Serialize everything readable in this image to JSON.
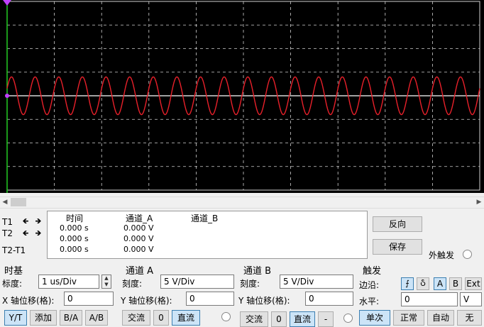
{
  "cursors": {
    "labels": [
      "T1",
      "T2",
      "T2-T1"
    ],
    "headers": {
      "time": "时间",
      "channel_a": "通道_A",
      "channel_b": "通道_B"
    },
    "rows": [
      {
        "time": "0.000 s",
        "channel_a": "0.000 V"
      },
      {
        "time": "0.000 s",
        "channel_a": "0.000 V"
      },
      {
        "time": "0.000 s",
        "channel_a": "0.000 V"
      }
    ]
  },
  "actions": {
    "reverse": "反向",
    "save": "保存",
    "ext_trigger": "外触发"
  },
  "timebase": {
    "title": "时基",
    "scale_label": "标度:",
    "scale_value": "1 us/Div",
    "xpos_label": "X 轴位移(格):",
    "xpos_value": "0",
    "modes": [
      "Y/T",
      "添加",
      "B/A",
      "A/B"
    ]
  },
  "channel_a": {
    "title": "通道 A",
    "scale_label": "刻度:",
    "scale_value": "5  V/Div",
    "ypos_label": "Y 轴位移(格):",
    "ypos_value": "0",
    "coupling": [
      "交流",
      "0",
      "直流"
    ]
  },
  "channel_b": {
    "title": "通道 B",
    "scale_label": "刻度:",
    "scale_value": "5  V/Div",
    "ypos_label": "Y 轴位移(格):",
    "ypos_value": "0",
    "coupling": [
      "交流",
      "0",
      "直流",
      "-"
    ]
  },
  "trigger": {
    "title": "触发",
    "edge_label": "边沿:",
    "edge_icons": [
      "rising-edge-icon",
      "falling-edge-icon"
    ],
    "sources": [
      "A",
      "B",
      "Ext"
    ],
    "level_label": "水平:",
    "level_value": "0",
    "level_unit": "V",
    "modes": [
      "单次",
      "正常",
      "自动",
      "无"
    ]
  },
  "colors": {
    "trace": "#e8202a",
    "grid": "#d0d0d0",
    "screen": "#000000",
    "axis": "#ffffff",
    "cursor_line": "#22cc22",
    "cursor_marker": "#c040ff"
  },
  "waveform": {
    "cycles_visible": 20,
    "amplitude_divs": 0.8,
    "offset_divs": 0
  }
}
